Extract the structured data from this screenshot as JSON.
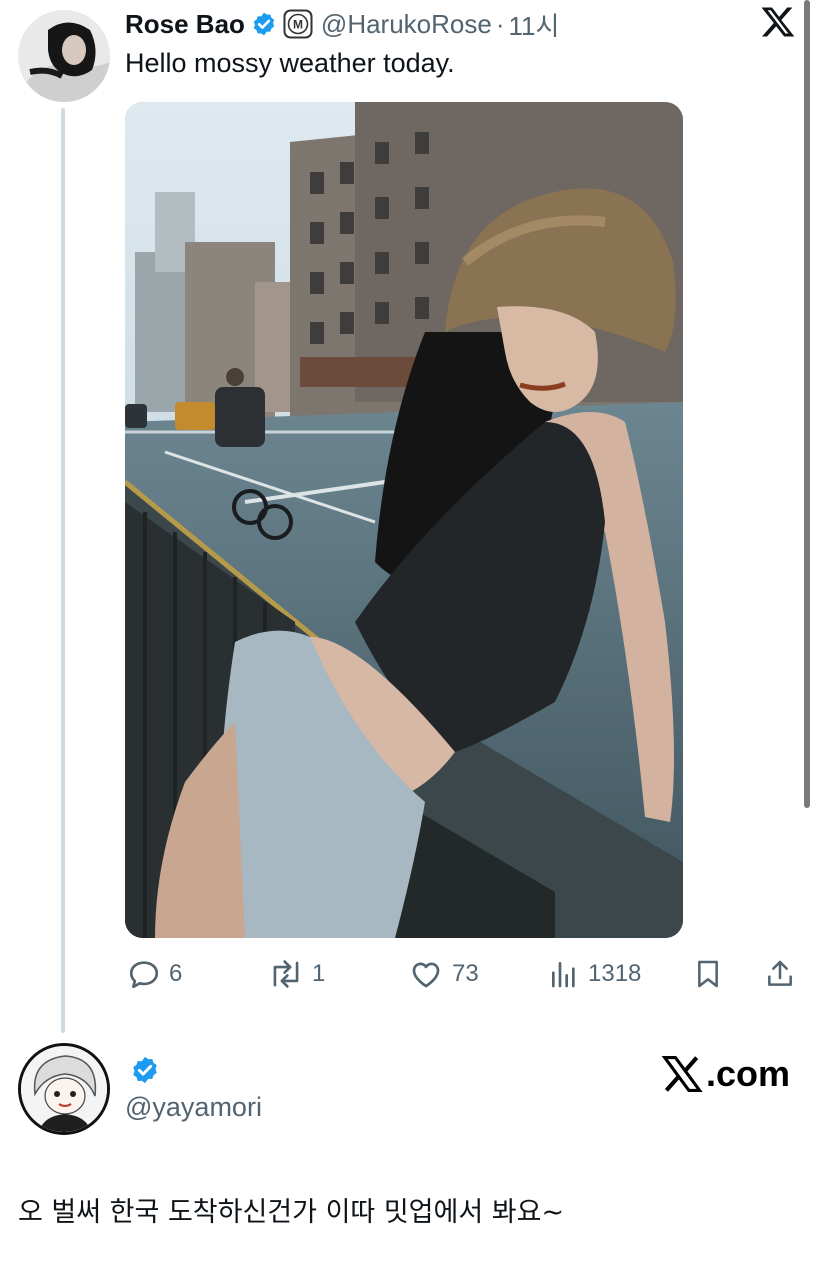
{
  "tweet": {
    "author": {
      "display_name": "Rose Bao",
      "handle": "@HarukoRose",
      "affiliate_badge": "M",
      "verified": true
    },
    "separator": "·",
    "time": "11시",
    "text": "Hello mossy weather today.",
    "media_description": "photo",
    "stats": {
      "replies": "6",
      "retweets": "1",
      "likes": "73",
      "views": "1318"
    }
  },
  "reply": {
    "handle": "@yayamori",
    "verified": true,
    "text": "오 벌써 한국 도착하신건가 이따 밋업에서 봐요~"
  },
  "watermark": {
    "text": ".com",
    "brand": "X"
  },
  "colors": {
    "verified_blue": "#1d9bf0",
    "secondary_text": "#536471",
    "thread_line": "#cfd9de"
  }
}
